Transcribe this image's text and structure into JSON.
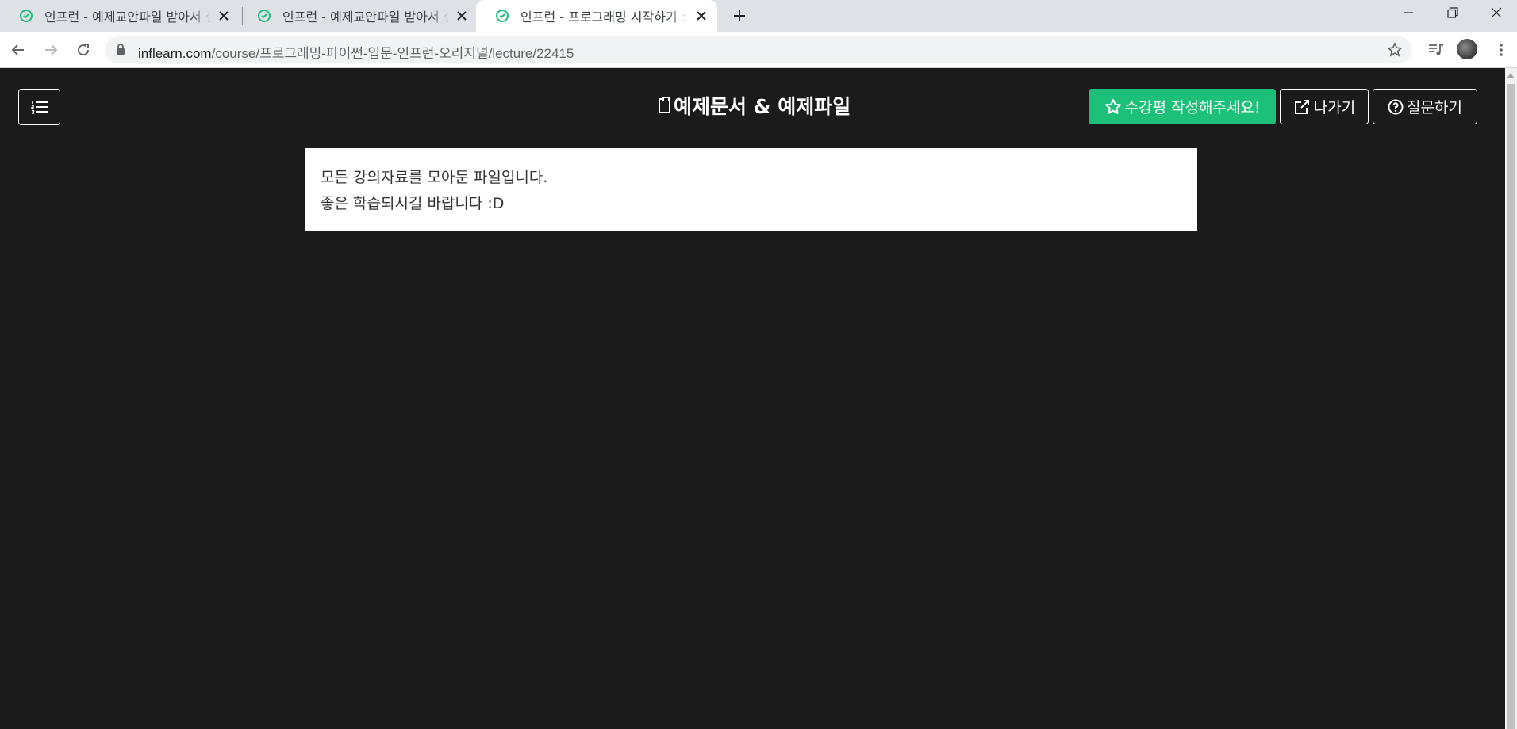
{
  "browser": {
    "tabs": [
      {
        "title": "인프런 - 예제교안파일 받아서 실",
        "active": false
      },
      {
        "title": "인프런 - 예제교안파일 받아서 실",
        "active": false
      },
      {
        "title": "인프런 - 프로그래밍 시작하기 :",
        "active": true
      }
    ],
    "url": {
      "host": "inflearn.com",
      "path": "/course/프로그래밍-파이썬-입문-인프런-오리지널/lecture/22415"
    }
  },
  "header": {
    "title": "예제문서 & 예제파일",
    "review_button": "수강평 작성해주세요!",
    "exit_button": "나가기",
    "question_button": "질문하기"
  },
  "content": {
    "lines": [
      "모든 강의자료를 모아둔 파일입니다.",
      "좋은 학습되시길 바랍니다 :D"
    ]
  },
  "colors": {
    "page_background": "#1b1b1b",
    "accent_green": "#1dc078",
    "tab_strip": "#dee1e6"
  }
}
